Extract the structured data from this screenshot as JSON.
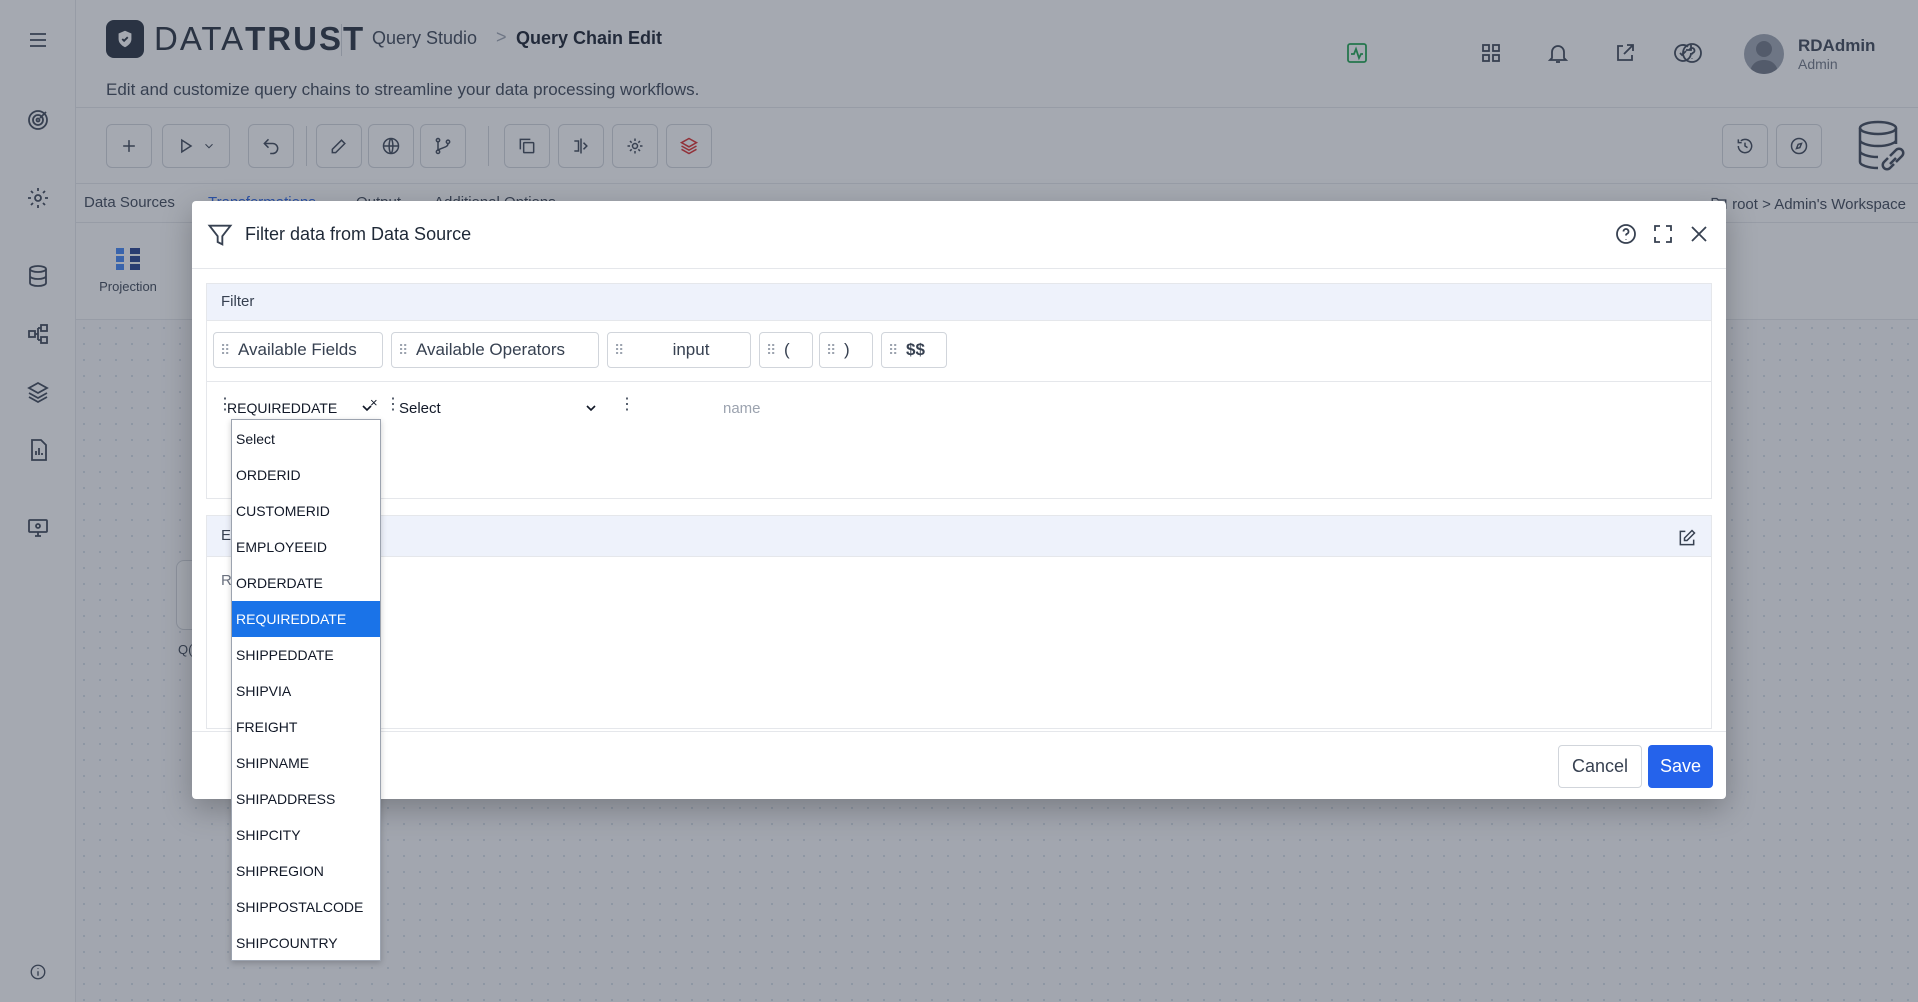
{
  "header": {
    "brand_light": "DATA",
    "brand_bold": "TRUST",
    "breadcrumb_parent": "Query Studio",
    "breadcrumb_separator": ">",
    "breadcrumb_current": "Query Chain Edit",
    "subtitle": "Edit and customize query chains to streamline your data processing workflows.",
    "user_name": "RDAdmin",
    "user_role": "Admin"
  },
  "tabs": {
    "data_sources": "Data Sources",
    "transformations": "Transformations",
    "output": "Output",
    "additional_options": "Additional Options",
    "workspace_path": "root > Admin's Workspace"
  },
  "palette": {
    "projection": "Projection"
  },
  "canvas": {
    "node_label": "Q("
  },
  "modal": {
    "title": "Filter data from Data Source",
    "filter_section": {
      "title": "Filter",
      "chips": [
        "Available Fields",
        "Available Operators",
        "input",
        "(",
        ")",
        "$$"
      ],
      "condition": {
        "field_value": "REQUIREDDATE",
        "clear_symbol": "×",
        "operator_value": "Select",
        "name_placeholder": "name"
      }
    },
    "second_section": {
      "title_partial": "E",
      "text_partial": "R"
    },
    "footer": {
      "cancel_label": "Cancel",
      "save_label": "Save"
    }
  },
  "dropdown": {
    "selected": "REQUIREDDATE",
    "options": [
      "Select",
      "ORDERID",
      "CUSTOMERID",
      "EMPLOYEEID",
      "ORDERDATE",
      "REQUIREDDATE",
      "SHIPPEDDATE",
      "SHIPVIA",
      "FREIGHT",
      "SHIPNAME",
      "SHIPADDRESS",
      "SHIPCITY",
      "SHIPREGION",
      "SHIPPOSTALCODE",
      "SHIPCOUNTRY"
    ]
  },
  "colors": {
    "accent": "#2563eb",
    "selected_option": "#1a73e8",
    "panel_header": "#eef2fb"
  },
  "icons": {
    "sidebar": [
      "menu-icon",
      "target-icon",
      "settings-icon",
      "database-icon",
      "workflow-icon",
      "layers-icon",
      "report-icon",
      "monitor-icon",
      "info-icon"
    ],
    "header": [
      "activity-icon",
      "grid-icon",
      "bell-icon",
      "external-link-icon",
      "help-icon",
      "refresh-check-icon"
    ]
  }
}
